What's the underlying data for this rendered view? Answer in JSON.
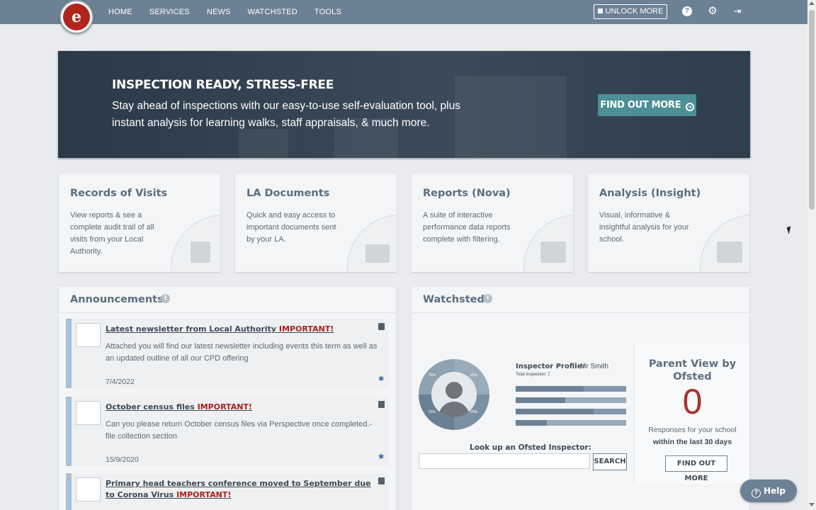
{
  "nav": {
    "items": [
      "HOME",
      "SERVICES",
      "NEWS",
      "WATCHSTED",
      "TOOLS"
    ],
    "unlock_label": "UNLOCK MORE",
    "icons": [
      "question-icon",
      "gear-icon",
      "logout-icon"
    ],
    "logo_glyph": "e"
  },
  "banner": {
    "title": "INSPECTION READY, STRESS-FREE",
    "text": "Stay ahead of inspections with our easy-to-use self-evaluation tool, plus instant analysis for learning walks, staff appraisals, & much more.",
    "button_label": "FIND OUT MORE"
  },
  "cards": [
    {
      "title": "Records of Visits",
      "desc": "View reports & see a complete audit trail of all visits from your Local Authority.",
      "icon": "clipboard-icon"
    },
    {
      "title": "LA Documents",
      "desc": "Quick and easy access to important documents sent by your LA.",
      "icon": "folder-icon"
    },
    {
      "title": "Reports (Nova)",
      "desc": "A suite of interactive performance data reports complete with filtering.",
      "icon": "report-chart-icon"
    },
    {
      "title": "Analysis (Insight)",
      "desc": "Visual, informative & insightful analysis for your school.",
      "icon": "analysis-chart-icon"
    }
  ],
  "announcements": {
    "title": "Announcements",
    "items": [
      {
        "title": "Latest newsletter from Local Authority",
        "flag": "IMPORTANT!",
        "body": "Attached you will find our latest newsletter including events this term as well as an updated outline of all our CPD offering",
        "date": "7/4/2022"
      },
      {
        "title": "October census files",
        "flag": "IMPORTANT!",
        "body": "Can you please return October census files via Perspective once completed.- file collection section",
        "date": "15/9/2020"
      },
      {
        "title": "Primary head teachers conference moved to September due to Corona Virus",
        "flag": "IMPORTANT!",
        "body": "",
        "date": ""
      }
    ]
  },
  "watchsted": {
    "title": "Watchsted",
    "inspector_label": "Inspector Profile:",
    "inspector_name": "Mr Smith",
    "total_label": "Total Inspection: 7",
    "donut_labels": [
      "25%",
      "25%",
      "25%",
      "25%"
    ],
    "lookup_label": "Look up an Ofsted Inspector:",
    "lookup_value": "",
    "search_label": "SEARCH",
    "parent_view": {
      "title": "Parent View by Ofsted",
      "count": "0",
      "desc_line1": "Responses for your school",
      "desc_line2": "within the last 30 days",
      "button_label": "FIND OUT MORE"
    }
  },
  "help_label": "Help",
  "colors": {
    "nav": "#6d8194",
    "banner": "#2f3e4c",
    "accent": "#4d8f96",
    "important": "#a8221a",
    "count": "#a8332b"
  }
}
